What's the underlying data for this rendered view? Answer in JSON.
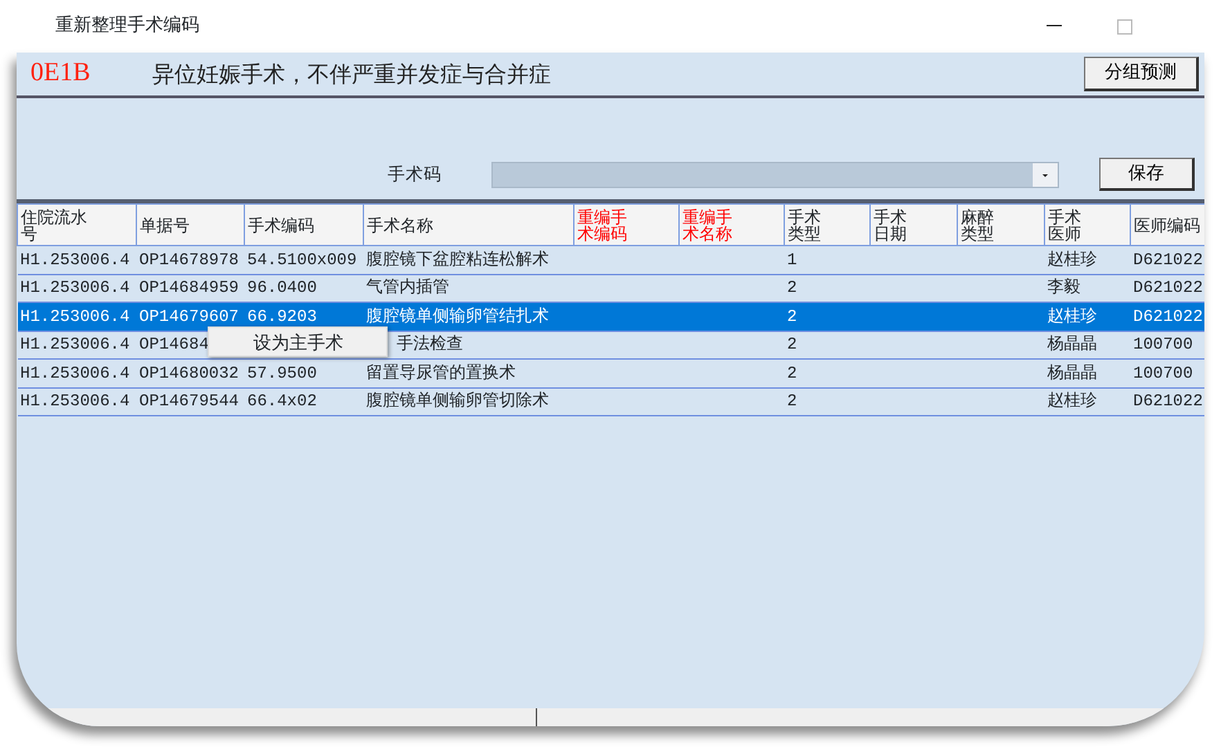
{
  "window": {
    "title": "重新整理手术编码"
  },
  "group": {
    "code": "0E1B",
    "name": "异位妊娠手术，不伴严重并发症与合并症",
    "predict_button": "分组预测"
  },
  "surgery_code": {
    "label": "手术码",
    "save_button": "保存"
  },
  "table": {
    "columns": [
      {
        "label": "住院流水号",
        "highlight": false
      },
      {
        "label": "单据号",
        "highlight": false
      },
      {
        "label": "手术编码",
        "highlight": false
      },
      {
        "label": "手术名称",
        "highlight": false
      },
      {
        "label": "重编手术编码",
        "highlight": true
      },
      {
        "label": "重编手术名称",
        "highlight": true
      },
      {
        "label": "手术类型",
        "highlight": false
      },
      {
        "label": "手术日期",
        "highlight": false
      },
      {
        "label": "麻醉类型",
        "highlight": false
      },
      {
        "label": "手术医师",
        "highlight": false
      },
      {
        "label": "医师编码",
        "highlight": false
      }
    ],
    "rows": [
      {
        "selected": false,
        "cells": [
          "H1.253006.4",
          "OP14678978",
          "54.5100x009",
          "腹腔镜下盆腔粘连松解术",
          null,
          null,
          "1",
          null,
          null,
          "赵桂珍",
          "D621022"
        ]
      },
      {
        "selected": false,
        "cells": [
          "H1.253006.4",
          "OP14684959",
          "96.0400",
          "气管内插管",
          null,
          null,
          "2",
          null,
          null,
          "李毅",
          "D621022"
        ]
      },
      {
        "selected": true,
        "cells": [
          "H1.253006.4",
          "OP14679607",
          "66.9203",
          "腹腔镜单侧输卵管结扎术",
          null,
          null,
          "2",
          null,
          null,
          "赵桂珍",
          "D621022"
        ]
      },
      {
        "selected": false,
        "cells": [
          "H1.253006.4",
          "OP14684",
          null,
          "手法检查",
          null,
          null,
          "2",
          null,
          null,
          "杨晶晶",
          "100700"
        ]
      },
      {
        "selected": false,
        "cells": [
          "H1.253006.4",
          "OP14680032",
          "57.9500",
          "留置导尿管的置换术",
          null,
          null,
          "2",
          null,
          null,
          "杨晶晶",
          "100700"
        ]
      },
      {
        "selected": false,
        "cells": [
          "H1.253006.4",
          "OP14679544",
          "66.4x02",
          "腹腔镜单侧输卵管切除术",
          null,
          null,
          "2",
          null,
          null,
          "赵桂珍",
          "D621022"
        ]
      }
    ]
  },
  "context_menu": {
    "items": [
      {
        "label": "设为主手术"
      }
    ]
  }
}
